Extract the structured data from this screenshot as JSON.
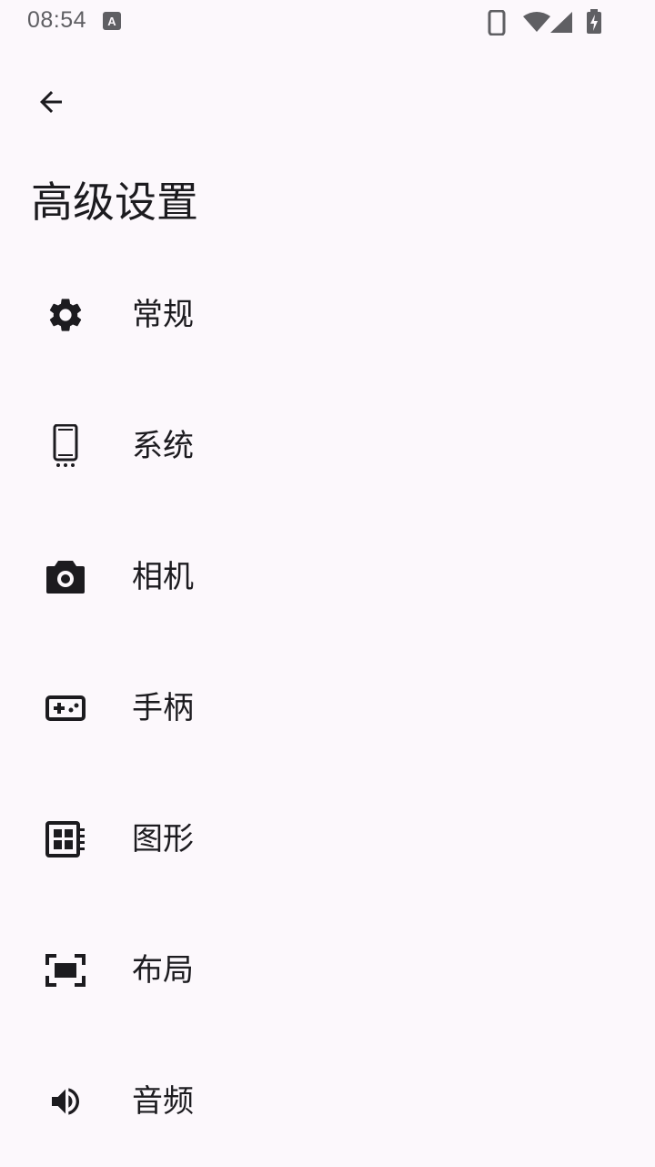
{
  "status_bar": {
    "time": "08:54",
    "icons": [
      "a-accessibility-icon",
      "phone-icon",
      "wifi-icon",
      "signal-icon",
      "battery-charging-icon"
    ]
  },
  "header": {
    "back_icon": "arrow-back-icon",
    "title": "高级设置"
  },
  "menu": {
    "items": [
      {
        "label": "常规",
        "icon": "gear-icon"
      },
      {
        "label": "系统",
        "icon": "phone-icon"
      },
      {
        "label": "相机",
        "icon": "camera-icon"
      },
      {
        "label": "手柄",
        "icon": "gamepad-icon"
      },
      {
        "label": "图形",
        "icon": "graphics-chip-icon"
      },
      {
        "label": "布局",
        "icon": "fullscreen-layout-icon"
      },
      {
        "label": "音频",
        "icon": "volume-icon"
      }
    ]
  },
  "colors": {
    "background": "#fcf8fc",
    "text": "#1c1b1f",
    "status_text": "#5f5f63"
  }
}
